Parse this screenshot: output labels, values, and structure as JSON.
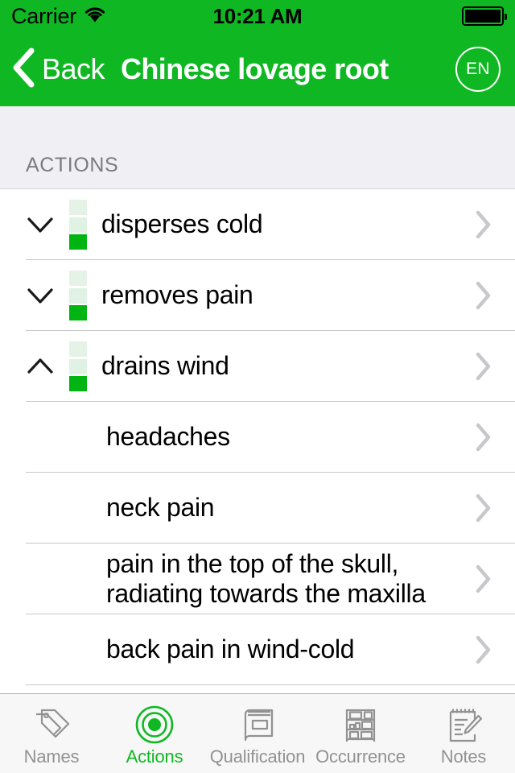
{
  "theme": {
    "brand_green": "#0FB823",
    "section_bg": "#EFEFF4",
    "separator": "#C8C7CC",
    "chevron_gray": "#C7C7CC",
    "tab_inactive": "#929292",
    "level_light_1": "#E4F3E6",
    "level_light_2": "#DFF2E3",
    "level_solid": "#00B512"
  },
  "status_bar": {
    "carrier": "Carrier",
    "wifi_icon": "wifi-icon",
    "time": "10:21 AM",
    "battery_icon": "battery-full-icon"
  },
  "nav_bar": {
    "back_icon": "chevron-left-icon",
    "back_label": "Back",
    "title": "Chinese lovage root",
    "language_badge": "EN"
  },
  "section": {
    "header": "ACTIONS"
  },
  "rows": [
    {
      "label": "disperses cold",
      "type": "parent",
      "expanded": false,
      "toggle_icon": "chevron-down-icon",
      "accessory_icon": "chevron-right-icon",
      "level_segments": [
        "#E4F3E6",
        "#DFF2E3",
        "#00B512"
      ]
    },
    {
      "label": "removes pain",
      "type": "parent",
      "expanded": false,
      "toggle_icon": "chevron-down-icon",
      "accessory_icon": "chevron-right-icon",
      "level_segments": [
        "#E4F3E6",
        "#DFF2E3",
        "#00B512"
      ]
    },
    {
      "label": "drains wind",
      "type": "parent",
      "expanded": true,
      "toggle_icon": "chevron-up-icon",
      "accessory_icon": "chevron-right-icon",
      "level_segments": [
        "#E4F3E6",
        "#DFF2E3",
        "#00B512"
      ]
    },
    {
      "label": "headaches",
      "type": "child",
      "accessory_icon": "chevron-right-icon"
    },
    {
      "label": "neck pain",
      "type": "child",
      "accessory_icon": "chevron-right-icon"
    },
    {
      "label": "pain in the top of the skull,\nradiating towards the maxilla",
      "type": "child",
      "multiline": true,
      "accessory_icon": "chevron-right-icon"
    },
    {
      "label": "back pain in wind-cold",
      "type": "child",
      "accessory_icon": "chevron-right-icon"
    }
  ],
  "tab_bar": {
    "active_index": 1,
    "items": [
      {
        "label": "Names",
        "icon": "tags-icon"
      },
      {
        "label": "Actions",
        "icon": "target-icon"
      },
      {
        "label": "Qualification",
        "icon": "book-icon"
      },
      {
        "label": "Occurrence",
        "icon": "shelf-icon"
      },
      {
        "label": "Notes",
        "icon": "notepad-pencil-icon"
      }
    ]
  }
}
